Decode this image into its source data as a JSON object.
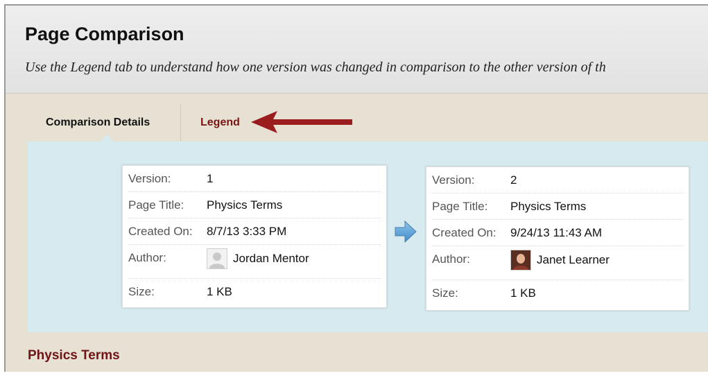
{
  "page": {
    "title": "Page Comparison",
    "subtitle": "Use the Legend tab to understand how one version was changed in comparison to the other version of th"
  },
  "tabs": [
    {
      "label": "Comparison Details",
      "active": true
    },
    {
      "label": "Legend",
      "active": false
    }
  ],
  "versions": [
    {
      "version_label": "Version:",
      "version": "1",
      "title_label": "Page Title:",
      "page_title": "Physics Terms",
      "created_label": "Created On:",
      "created_on": "8/7/13 3:33 PM",
      "author_label": "Author:",
      "author": "Jordan Mentor",
      "avatar_icon": "default-user-avatar",
      "size_label": "Size:",
      "size": "1 KB"
    },
    {
      "version_label": "Version:",
      "version": "2",
      "title_label": "Page Title:",
      "page_title": "Physics Terms",
      "created_label": "Created On:",
      "created_on": "9/24/13 11:43 AM",
      "author_label": "Author:",
      "author": "Janet Learner",
      "avatar_icon": "user-photo-avatar",
      "size_label": "Size:",
      "size": "1 KB"
    }
  ],
  "content": {
    "section_title": "Physics Terms"
  },
  "colors": {
    "accent_red": "#7a1616",
    "panel_blue": "#d6eaf0",
    "background_tan": "#e6e1d2"
  }
}
